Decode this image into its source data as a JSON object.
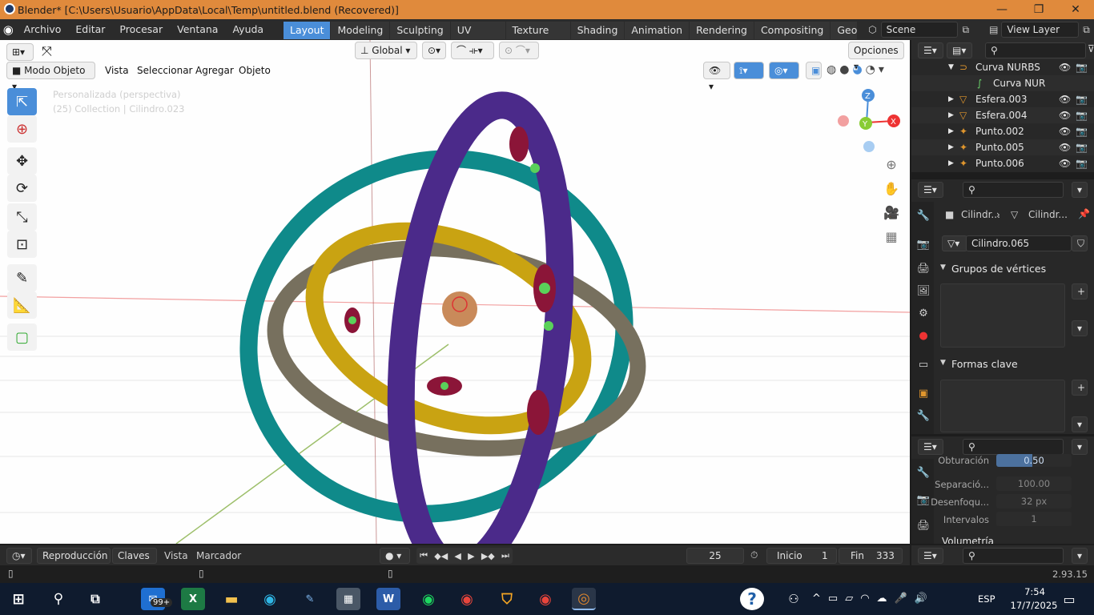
{
  "window": {
    "title": "Blender* [C:\\Users\\Usuario\\AppData\\Local\\Temp\\untitled.blend (Recovered)]",
    "min": "—",
    "max": "❐",
    "close": "✕"
  },
  "menu": [
    "Archivo",
    "Editar",
    "Procesar",
    "Ventana",
    "Ayuda"
  ],
  "workspaces": [
    {
      "label": "Layout",
      "active": true
    },
    {
      "label": "Modeling"
    },
    {
      "label": "Sculpting"
    },
    {
      "label": "UV Editing"
    },
    {
      "label": "Texture Paint"
    },
    {
      "label": "Shading"
    },
    {
      "label": "Animation"
    },
    {
      "label": "Rendering"
    },
    {
      "label": "Compositing"
    },
    {
      "label": "Geom"
    }
  ],
  "scene": "Scene",
  "view_layer": "View Layer",
  "viewport": {
    "transform_orientation": "Global",
    "options_label": "Opciones",
    "mode": "Modo Objeto",
    "menus": [
      "Vista",
      "Seleccionar",
      "Agregar",
      "Objeto"
    ],
    "info_line1": "Personalizada (perspectiva)",
    "info_line2": "(25) Collection | Cilindro.023",
    "gizmo": {
      "x": "X",
      "y": "Y",
      "z": "Z"
    }
  },
  "outliner": {
    "rows": [
      {
        "name": "Curva NURBS",
        "icon": "curve-icon",
        "indent": 1,
        "expanded": true
      },
      {
        "name": "Curva NUR",
        "icon": "curve-data-icon",
        "indent": 2
      },
      {
        "name": "Esfera.003",
        "icon": "mesh-icon",
        "indent": 1
      },
      {
        "name": "Esfera.004",
        "icon": "mesh-icon",
        "indent": 1
      },
      {
        "name": "Punto.002",
        "icon": "light-icon",
        "indent": 1
      },
      {
        "name": "Punto.005",
        "icon": "light-icon",
        "indent": 1
      },
      {
        "name": "Punto.006",
        "icon": "light-icon",
        "indent": 1
      }
    ]
  },
  "properties": {
    "breadcrumb_obj": "Cilindr...",
    "breadcrumb_mesh": "Cilindr...",
    "mesh_name": "Cilindro.065",
    "vertex_groups": "Grupos de vértices",
    "shape_keys": "Formas clave"
  },
  "render_props": {
    "fields": [
      {
        "label": "Obturación",
        "value": "0.50"
      },
      {
        "label": "Separació...",
        "value": "100.00"
      },
      {
        "label": "Desenfoqu...",
        "value": "32 px"
      },
      {
        "label": "Intervalos",
        "value": "1"
      }
    ],
    "next_section": "Volumetría"
  },
  "timeline": {
    "menus": [
      "Reproducción",
      "Claves",
      "Vista",
      "Marcador"
    ],
    "current_frame": "25",
    "start_label": "Inicio",
    "start": "1",
    "end_label": "Fin",
    "end": "333"
  },
  "status": {
    "version": "2.93.15"
  },
  "taskbar": {
    "mail_badge": "99+",
    "lang": "ESP",
    "time": "7:54",
    "date": "17/7/2025"
  },
  "colors": {
    "accent": "#4a8ed9",
    "titlebar": "#e08a3c",
    "taskbar": "#0f1b2e"
  }
}
